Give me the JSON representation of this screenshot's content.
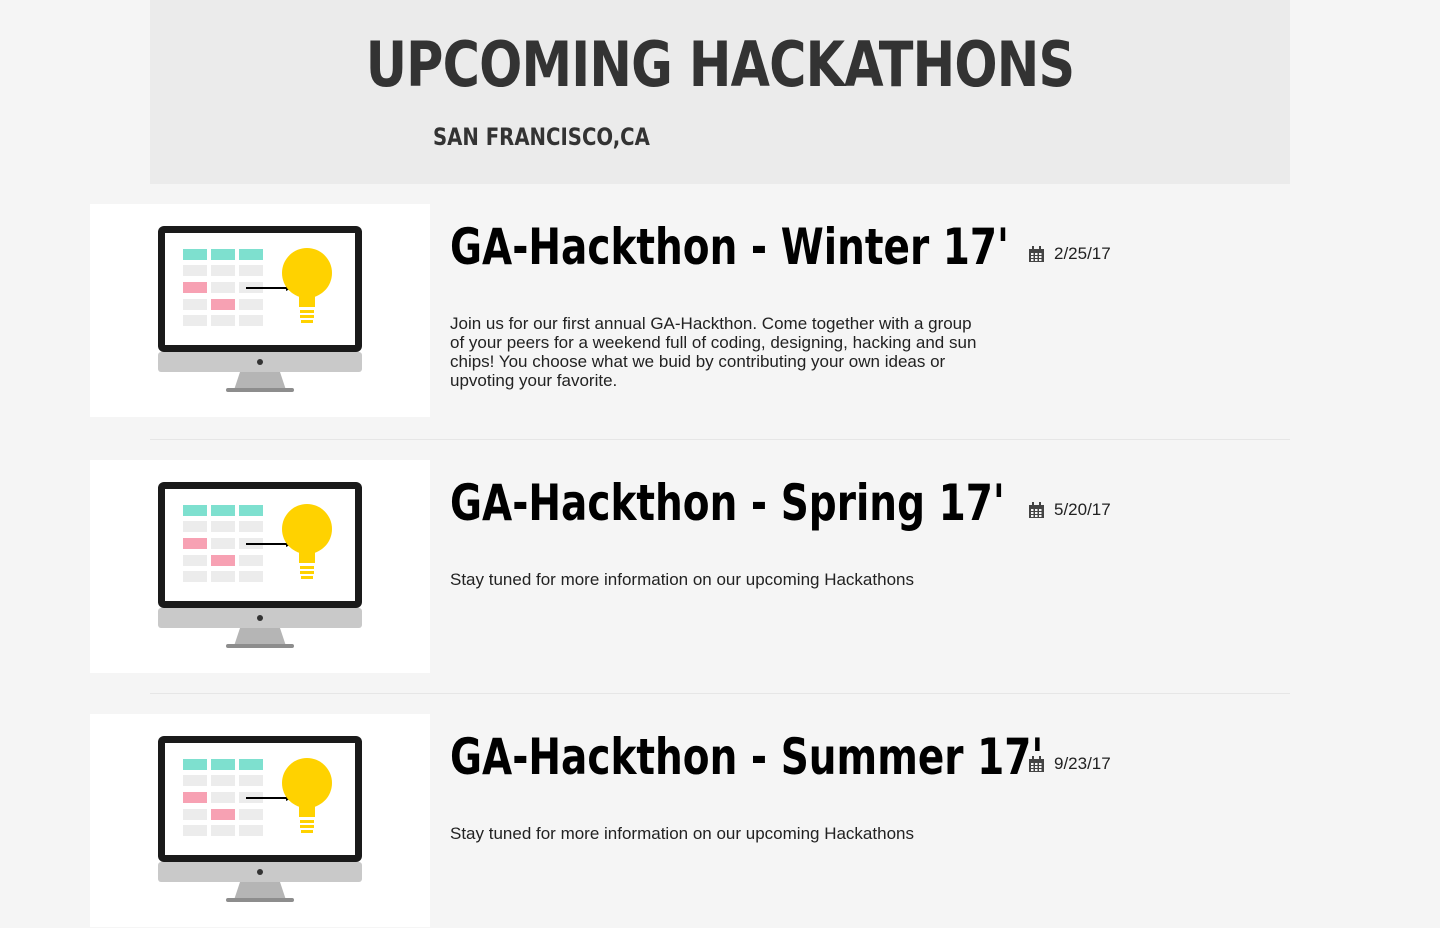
{
  "header": {
    "title": "UPCOMING HACKATHONS",
    "location": "SAN FRANCISCO,CA"
  },
  "events": [
    {
      "title": "GA-Hackthon - Winter 17'",
      "date": "2/25/17",
      "description": "Join us for our first annual GA-Hackthon. Come together with a group of your peers for a weekend full of coding, designing, hacking and sun chips! You choose what we buid by contributing your own ideas or upvoting your favorite.",
      "image_icon": "monitor-lightbulb-illustration",
      "date_icon": "calendar-icon"
    },
    {
      "title": "GA-Hackthon - Spring 17'",
      "date": "5/20/17",
      "description": "Stay tuned for more information on our upcoming Hackathons",
      "image_icon": "monitor-lightbulb-illustration",
      "date_icon": "calendar-icon"
    },
    {
      "title": "GA-Hackthon - Summer 17'",
      "date": "9/23/17",
      "description": "Stay tuned for more information on our upcoming Hackathons",
      "image_icon": "monitor-lightbulb-illustration",
      "date_icon": "calendar-icon"
    }
  ],
  "colors": {
    "page_background": "#f5f5f5",
    "header_background": "#ebebeb",
    "heading_text": "#333333",
    "bulb_yellow": "#ffd200",
    "cell_teal": "#7ee0cf",
    "cell_pink": "#f7a1b3"
  }
}
